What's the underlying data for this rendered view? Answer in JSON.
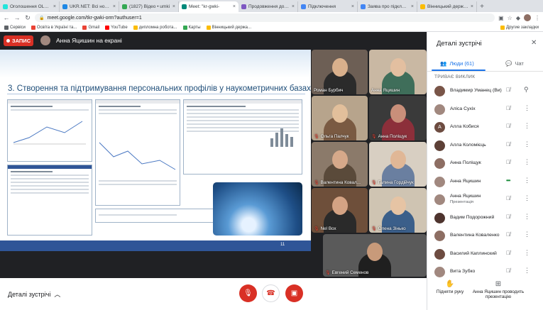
{
  "browser": {
    "tabs": [
      {
        "title": "Оголошення OLX.ua:",
        "color": "#23e5db",
        "active": false
      },
      {
        "title": "UKR.NET: Всі новини",
        "color": "#1e88e5",
        "active": false
      },
      {
        "title": "(1827) Відео • umki",
        "color": "#34a853",
        "active": false
      },
      {
        "title": "Meet: \"kr-gwki-",
        "color": "#00897b",
        "active": true
      },
      {
        "title": "Продовження догов",
        "color": "#7e57c2",
        "active": false
      },
      {
        "title": "Підключення",
        "color": "#4285f4",
        "active": false
      },
      {
        "title": "Заява про підключе",
        "color": "#4285f4",
        "active": false
      },
      {
        "title": "Вінницький держав",
        "color": "#fbbc04",
        "active": false
      }
    ],
    "url": "meet.google.com/tkr-gwki-orm?authuser=1",
    "bookmarks": [
      {
        "label": "Сервіси",
        "color": "#5f6368"
      },
      {
        "label": "Освіта в Україні та...",
        "color": "#ea4335"
      },
      {
        "label": "Gmail",
        "color": "#ea4335"
      },
      {
        "label": "YouTube",
        "color": "#ff0000"
      },
      {
        "label": "дипломна робота...",
        "color": "#fbbc04"
      },
      {
        "label": "Карты",
        "color": "#34a853"
      },
      {
        "label": "Вінницький держа...",
        "color": "#fbbc04"
      }
    ],
    "other_bookmarks": "Другие закладки"
  },
  "meet": {
    "record_label": "ЗАПИС",
    "presenter_label": "Анна Яцишин на екрані",
    "slide": {
      "title": "3. Створення та підтримування персональних профілів у наукометричних базах",
      "page": "11"
    },
    "tiles": [
      {
        "name": "Роман Бурбич",
        "bg": "#6d5f55",
        "skin": "#d9b08c",
        "cloth": "#2b2b2b",
        "muted": false
      },
      {
        "name": "Анна Яцишин",
        "bg": "#c9b8a3",
        "skin": "#e3bfa0",
        "cloth": "#3f6e5a",
        "muted": false
      },
      {
        "name": "Ольга Палчук",
        "bg": "#b7a48c",
        "skin": "#e2bf9b",
        "cloth": "#7a5a42",
        "muted": true
      },
      {
        "name": "Анна Поліщук",
        "bg": "#3a3a3a",
        "skin": "#c98f7a",
        "cloth": "#8c2f3a",
        "muted": true
      },
      {
        "name": "Валентина Ковал...",
        "bg": "#8b7a6a",
        "skin": "#d6a98a",
        "cloth": "#5a4a3a",
        "muted": true
      },
      {
        "name": "Галина Гордійчук",
        "bg": "#d8cfc2",
        "skin": "#e0b796",
        "cloth": "#6a7fa0",
        "muted": true
      },
      {
        "name": "Nel Box",
        "bg": "#6e4f3a",
        "skin": "#d4a384",
        "cloth": "#2a2a2a",
        "muted": true
      },
      {
        "name": "Олена Зінько",
        "bg": "#cfc4b2",
        "skin": "#e6c4a4",
        "cloth": "#3b5f8a",
        "muted": true
      },
      {
        "name": "Евгений Семенов",
        "bg": "#5a5a5a",
        "skin": "#c89a7a",
        "cloth": "#1f1f1f",
        "muted": true
      }
    ]
  },
  "panel": {
    "title": "Деталі зустрічі",
    "close_icon": "close-icon",
    "tab_people": "Люди (61)",
    "tab_chat": "Чат",
    "section_label": "ТРИВАЄ ВИКЛИК",
    "people": [
      {
        "name": "Владимир Уманец (Ви)",
        "initial": "",
        "color": "#795548",
        "sub": "",
        "active": false
      },
      {
        "name": "Аліса Сухіх",
        "initial": "",
        "color": "#a1887f",
        "sub": "",
        "active": false
      },
      {
        "name": "Алла Кобися",
        "initial": "А",
        "color": "#6d4c41",
        "sub": "",
        "active": false
      },
      {
        "name": "Алла Коломієць",
        "initial": "",
        "color": "#5d4037",
        "sub": "",
        "active": false
      },
      {
        "name": "Анна Поліщук",
        "initial": "",
        "color": "#8d6e63",
        "sub": "",
        "active": false
      },
      {
        "name": "Анна Яцишин",
        "initial": "",
        "color": "#a1887f",
        "sub": "",
        "active": true
      },
      {
        "name": "Анна Яцишин",
        "initial": "",
        "color": "#a1887f",
        "sub": "Презентація",
        "active": false
      },
      {
        "name": "Вадим Подорожний",
        "initial": "",
        "color": "#4e342e",
        "sub": "",
        "active": false
      },
      {
        "name": "Валентина Коваленко",
        "initial": "",
        "color": "#8d6e63",
        "sub": "",
        "active": false
      },
      {
        "name": "Василий Каплинский",
        "initial": "",
        "color": "#6d4c41",
        "sub": "",
        "active": false
      },
      {
        "name": "Вита Зубко",
        "initial": "",
        "color": "#a1887f",
        "sub": "",
        "active": false
      }
    ]
  },
  "bottom": {
    "details_label": "Деталі зустрічі",
    "raise_hand": "Підняти руку",
    "presenting": "Анна Яцишин проводить презентацію"
  }
}
